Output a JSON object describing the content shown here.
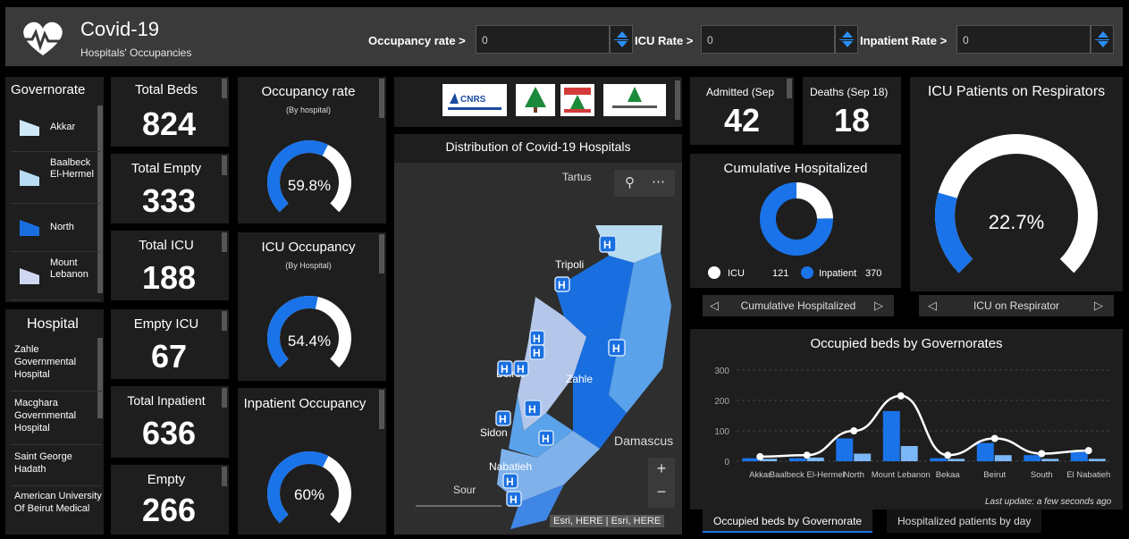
{
  "header": {
    "title": "Covid-19",
    "subtitle": "Hospitals' Occupancies",
    "filters": [
      {
        "label": "Occupancy rate >",
        "value": "0"
      },
      {
        "label": "ICU Rate >",
        "value": "0"
      },
      {
        "label": "Inpatient Rate >",
        "value": "0"
      }
    ]
  },
  "governorate": {
    "title": "Governorate",
    "items": [
      {
        "name": "Akkar",
        "color": "#cfe8f7"
      },
      {
        "name": "Baalbeck El-Hermel",
        "color": "#b9dcf3"
      },
      {
        "name": "North",
        "color": "#1a6fe0"
      },
      {
        "name": "Mount Lebanon",
        "color": "#cfd8f0"
      }
    ]
  },
  "hospital": {
    "title": "Hospital",
    "items": [
      "Zahle Governmental Hospital",
      "Macghara Governmental Hospital",
      "Saint George Hadath",
      "American University Of Beirut Medical"
    ]
  },
  "stats": [
    {
      "label": "Total Beds",
      "value": "824"
    },
    {
      "label": "Total Empty",
      "value": "333"
    },
    {
      "label": "Total ICU",
      "value": "188"
    },
    {
      "label": "Empty ICU",
      "value": "67"
    },
    {
      "label": "Total Inpatient",
      "value": "636"
    },
    {
      "label": "Empty",
      "value": "266"
    }
  ],
  "gauges": [
    {
      "label": "Occupancy rate",
      "sub": "(By hospital)",
      "value": "59.8%",
      "fraction": 0.598
    },
    {
      "label": "ICU Occupancy",
      "sub": "(By Hospital)",
      "value": "54.4%",
      "fraction": 0.544
    },
    {
      "label": "Inpatient Occupancy",
      "sub": "",
      "value": "60%",
      "fraction": 0.6
    }
  ],
  "map": {
    "title": "Distribution of Covid-19 Hospitals",
    "attribution": "Esri, HERE | Esri, HERE",
    "labels": [
      "Tartus",
      "Tripoli",
      "Beirut",
      "Zahle",
      "Sidon",
      "Nabatieh",
      "Damascus",
      "Sour"
    ],
    "zoom_in": "+",
    "zoom_out": "−"
  },
  "admitted": {
    "label": "Admitted (Sep",
    "value": "42"
  },
  "deaths": {
    "label": "Deaths (Sep 18)",
    "value": "18"
  },
  "cumulative": {
    "title": "Cumulative Hospitalized",
    "legend": [
      {
        "name": "ICU",
        "value": "121",
        "color": "#ffffff"
      },
      {
        "name": "Inpatient",
        "value": "370",
        "color": "#1a73e8"
      }
    ],
    "nav_label": "Cumulative Hospitalized"
  },
  "icu_resp": {
    "title": "ICU Patients on Respirators",
    "value": "22.7%",
    "fraction": 0.227,
    "nav_label": "ICU on Respirator"
  },
  "occupied": {
    "title": "Occupied beds by Governorates",
    "last_update": "Last update: a few seconds ago",
    "tabs": [
      "Occupied beds by Governorate",
      "Hospitalized patients by day"
    ]
  },
  "chart_data": {
    "type": "bar",
    "title": "Occupied beds by Governorates",
    "categories": [
      "Akkar",
      "Baalbeck El-Hermel",
      "North",
      "Mount Lebanon",
      "Bekaa",
      "Beirut",
      "South",
      "El Nabatieh"
    ],
    "ylim": [
      0,
      300
    ],
    "yticks": [
      0,
      100,
      200,
      300
    ],
    "series": [
      {
        "values": [
          10,
          10,
          75,
          165,
          10,
          60,
          20,
          30
        ],
        "color": "#1a73e8"
      },
      {
        "values": [
          8,
          12,
          25,
          50,
          8,
          20,
          8,
          8
        ],
        "color": "#7cb7f7"
      }
    ],
    "line": {
      "values": [
        15,
        20,
        100,
        215,
        20,
        75,
        25,
        35
      ],
      "color": "#ffffff"
    }
  },
  "colors": {
    "accent": "#1a73e8",
    "panel": "#1e1e1e",
    "header": "#3a3a3a"
  }
}
